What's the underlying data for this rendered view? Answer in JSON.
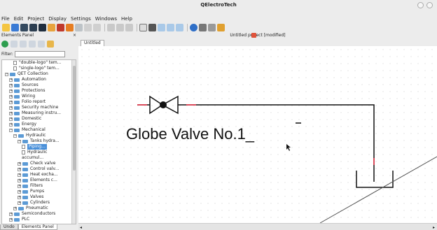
{
  "window": {
    "title": "QElectroTech"
  },
  "menu": [
    "File",
    "Edit",
    "Project",
    "Display",
    "Settings",
    "Windows",
    "Help"
  ],
  "elements_panel": {
    "title": "Elements Panel",
    "controls": "×",
    "filter_label": "Filter:",
    "filter_value": "",
    "tree": [
      {
        "label": "\"double-logo\" tem...",
        "depth": 2,
        "kind": "doc",
        "expander": ""
      },
      {
        "label": "\"single-logo\" tem...",
        "depth": 2,
        "kind": "doc",
        "expander": ""
      },
      {
        "label": "QET Collection",
        "depth": 0,
        "kind": "root",
        "expander": "−"
      },
      {
        "label": "Automation",
        "depth": 1,
        "kind": "folder",
        "expander": "+"
      },
      {
        "label": "Sources",
        "depth": 1,
        "kind": "folder",
        "expander": "+"
      },
      {
        "label": "Protections",
        "depth": 1,
        "kind": "folder",
        "expander": "+"
      },
      {
        "label": "Wiring",
        "depth": 1,
        "kind": "folder",
        "expander": "+"
      },
      {
        "label": "Folio report",
        "depth": 1,
        "kind": "folder",
        "expander": "+"
      },
      {
        "label": "Security machine",
        "depth": 1,
        "kind": "folder",
        "expander": "+"
      },
      {
        "label": "Measuring instru...",
        "depth": 1,
        "kind": "folder",
        "expander": "+"
      },
      {
        "label": "Domestic",
        "depth": 1,
        "kind": "folder",
        "expander": "+"
      },
      {
        "label": "Energy",
        "depth": 1,
        "kind": "folder",
        "expander": "+"
      },
      {
        "label": "Mechanical",
        "depth": 1,
        "kind": "folder",
        "expander": "−"
      },
      {
        "label": "Hydraulic",
        "depth": 2,
        "kind": "folder",
        "expander": "−"
      },
      {
        "label": "Tanks hydra...",
        "depth": 3,
        "kind": "folder",
        "expander": "−"
      },
      {
        "label": "Piping...",
        "depth": 4,
        "kind": "doc",
        "expander": "",
        "selected": true
      },
      {
        "label": "Hydraulic",
        "depth": 4,
        "kind": "doc",
        "expander": ""
      },
      {
        "label": "accumul...",
        "depth": 4,
        "kind": "text",
        "expander": ""
      },
      {
        "label": "Check valve",
        "depth": 3,
        "kind": "folder",
        "expander": "+"
      },
      {
        "label": "Control valv...",
        "depth": 3,
        "kind": "folder",
        "expander": "+"
      },
      {
        "label": "Heat excha...",
        "depth": 3,
        "kind": "folder",
        "expander": "+"
      },
      {
        "label": "Elements c...",
        "depth": 3,
        "kind": "folder",
        "expander": "+"
      },
      {
        "label": "Filters",
        "depth": 3,
        "kind": "folder",
        "expander": "+"
      },
      {
        "label": "Pumps",
        "depth": 3,
        "kind": "folder",
        "expander": "+"
      },
      {
        "label": "Valves",
        "depth": 3,
        "kind": "folder",
        "expander": "+"
      },
      {
        "label": "Cylinders",
        "depth": 3,
        "kind": "folder",
        "expander": "+"
      },
      {
        "label": "Pneumatic",
        "depth": 2,
        "kind": "folder",
        "expander": "+"
      },
      {
        "label": "Semiconductors",
        "depth": 1,
        "kind": "folder",
        "expander": "+"
      },
      {
        "label": "PLC",
        "depth": 1,
        "kind": "folder",
        "expander": "+"
      }
    ],
    "bottom_tabs": [
      "Undo",
      "Elements Panel"
    ]
  },
  "document": {
    "title": "Untitled project [modified]",
    "tab_label": "Untitled",
    "canvas_text": "Globe Valve No.1_"
  },
  "toolbar_icons": [
    "new-project-icon",
    "open-icon",
    "save-icon",
    "save-as-icon",
    "save-all-icon",
    "folio-add-icon",
    "folio-delete-icon",
    "undo-icon",
    "redo-icon",
    "cut-icon",
    "copy-icon",
    "paste-icon",
    "delete-icon",
    "rotate-icon",
    "select-icon",
    "move-icon",
    "zoom-in-icon",
    "zoom-out-icon",
    "zoom-fit-icon",
    "info-icon",
    "conductor-icon",
    "grid-icon",
    "terminal-icon"
  ],
  "colors": {
    "accent_blue": "#4a90d9",
    "close_red": "#e0533b",
    "conductor_red": "#d94a5a"
  }
}
